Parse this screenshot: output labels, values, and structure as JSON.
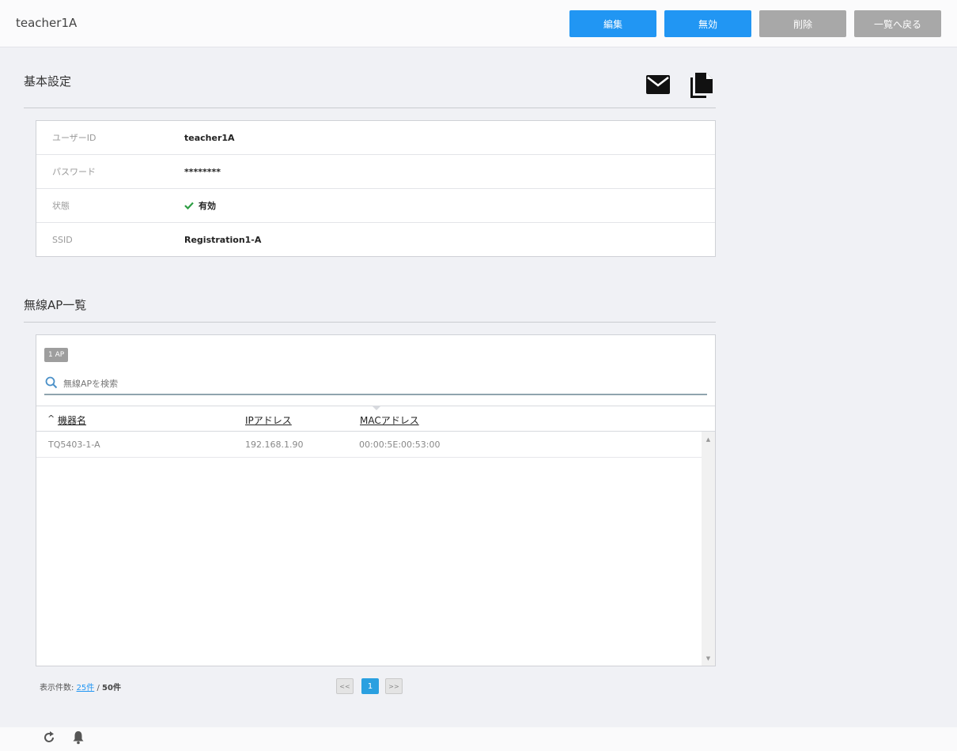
{
  "header": {
    "title": "teacher1A",
    "buttons": {
      "edit": "編集",
      "disable": "無効",
      "delete": "削除",
      "back": "一覧へ戻る"
    }
  },
  "basic_settings": {
    "title": "基本設定",
    "rows": [
      {
        "label": "ユーザーID",
        "value": "teacher1A"
      },
      {
        "label": "パスワード",
        "value": "********"
      },
      {
        "label": "状態",
        "value": "有効"
      },
      {
        "label": "SSID",
        "value": "Registration1-A"
      }
    ]
  },
  "ap_list": {
    "title": "無線AP一覧",
    "count_badge": "1 AP",
    "search_placeholder": "無線APを検索",
    "columns": [
      "機器名",
      "IPアドレス",
      "MACアドレス"
    ],
    "sort_indicator": "^",
    "rows": [
      {
        "name": "TQ5403-1-A",
        "ip": "192.168.1.90",
        "mac": "00:00:5E:00:53:00"
      }
    ]
  },
  "pagination": {
    "per_page_label": "表示件数:",
    "per_page_value": "25件",
    "separator": "/",
    "total": "50件",
    "prev": "<<",
    "current": "1",
    "next": ">>"
  },
  "colors": {
    "primary": "#2196f3",
    "muted_button": "#a8a8a8",
    "status_ok": "#2e9e44",
    "page_bg": "#f0f1f5"
  },
  "icons": [
    "mail-icon",
    "copy-icon",
    "check-icon",
    "search-icon",
    "refresh-icon",
    "bell-icon"
  ]
}
